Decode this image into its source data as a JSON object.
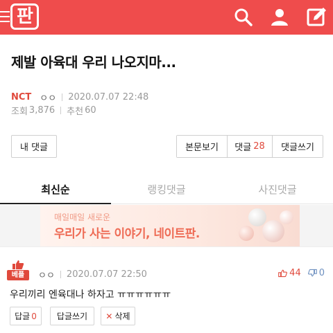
{
  "header": {
    "logo_text": "판",
    "icons": [
      "menu-icon",
      "search-icon",
      "user-icon",
      "write-icon"
    ],
    "accent_color": "#ef4c4c"
  },
  "post": {
    "title": "제발 아육대 우리 나오지마...",
    "board": "NCT",
    "author": "ㅇㅇ",
    "date": "2020.07.07 22:48",
    "views_label": "조회",
    "views": "3,876",
    "recommend_label": "추천",
    "recommend": "60"
  },
  "actions": {
    "my_comments": "내 댓글",
    "view_body": "본문보기",
    "comments_label": "댓글",
    "comments_count": "28",
    "write_comment": "댓글쓰기"
  },
  "tabs": [
    {
      "label": "최신순",
      "active": true
    },
    {
      "label": "랭킹댓글",
      "active": false
    },
    {
      "label": "사진댓글",
      "active": false
    }
  ],
  "banner": {
    "line1": "매일매일 새로운",
    "line2": "우리가 사는 이야기, 네이트판."
  },
  "comment": {
    "badge": "베플",
    "author": "ㅇㅇ",
    "date": "2020.07.07 22:50",
    "upvotes": "44",
    "downvotes": "0",
    "body": "우리끼리 엔육대나 하자고 ㅠㅠㅠㅠㅠㅠ",
    "reply_label": "답글",
    "reply_count": "0",
    "write_reply": "답글쓰기",
    "delete_label": "삭제",
    "delete_glyph": "✕"
  }
}
